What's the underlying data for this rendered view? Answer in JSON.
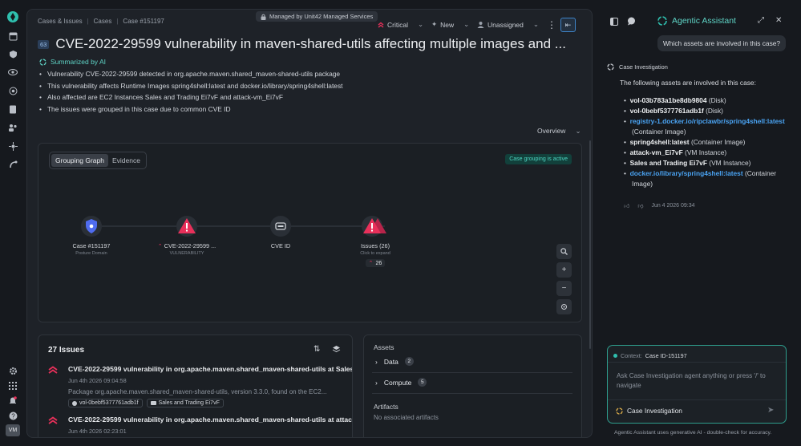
{
  "nav": {
    "avatar": "VM"
  },
  "breadcrumb": [
    "Cases & Issues",
    "Cases",
    "Case #151197"
  ],
  "managed_label": "Managed by Unit42 Managed Services",
  "header": {
    "severity": "Critical",
    "status": "New",
    "assignee": "Unassigned",
    "case_tag": "63",
    "title": "CVE-2022-29599 vulnerability in maven-shared-utils affecting multiple images and ..."
  },
  "summary": {
    "heading": "Summarized by AI",
    "bullets": [
      "Vulnerability CVE-2022-29599 detected in org.apache.maven.shared_maven-shared-utils package",
      "This vulnerability affects Runtime Images spring4shell:latest and docker.io/library/spring4shell:latest",
      "Also affected are EC2 Instances Sales and Trading Ei7vF and attack-vm_Ei7vF",
      "The issues were grouped in this case due to common CVE ID"
    ]
  },
  "overview_label": "Overview",
  "graph": {
    "tabs": [
      "Grouping Graph",
      "Evidence"
    ],
    "active_badge": "Case grouping is active",
    "nodes": [
      {
        "label": "Case #151197",
        "sub": "Posture Domain"
      },
      {
        "label": "CVE-2022-29599 ...",
        "sub": "VULNERABILITY"
      },
      {
        "label": "CVE ID",
        "sub": ""
      },
      {
        "label": "Issues (26)",
        "sub": "Click to expand"
      }
    ],
    "issue_count": "26"
  },
  "issues_panel": {
    "title": "27 Issues",
    "items": [
      {
        "title": "CVE-2022-29599 vulnerability in org.apache.maven.shared_maven-shared-utils at Sales...",
        "time": "Jun 4th 2026 09:04:58",
        "desc": "Package org.apache.maven.shared_maven-shared-utils, version 3.3.0, found on the EC2...",
        "chips": [
          "vol-0bebf5377761adb1f",
          "Sales and Trading Ei7vF"
        ]
      },
      {
        "title": "CVE-2022-29599 vulnerability in org.apache.maven.shared_maven-shared-utils at attac...",
        "time": "Jun 4th 2026 02:23:01"
      }
    ]
  },
  "assets_panel": {
    "title": "Assets",
    "groups": [
      {
        "label": "Data",
        "count": "2"
      },
      {
        "label": "Compute",
        "count": "5"
      }
    ],
    "artifacts_title": "Artifacts",
    "artifacts_empty": "No associated artifacts"
  },
  "assistant": {
    "title": "Agentic Assistant",
    "user_msg": "Which assets are involved in this case?",
    "agent_name": "Case Investigation",
    "intro": "The following assets are involved in this case:",
    "assets": [
      {
        "name": "vol-03b783a1be8db9804",
        "type": "(Disk)",
        "link": false
      },
      {
        "name": "vol-0bebf5377761adb1f",
        "type": "(Disk)",
        "link": false
      },
      {
        "name": "registry-1.docker.io/ripclawbr/spring4shell:latest",
        "type": "(Container Image)",
        "link": true
      },
      {
        "name": "spring4shell:latest",
        "type": "(Container Image)",
        "link": false
      },
      {
        "name": "attack-vm_Ei7vF",
        "type": "(VM Instance)",
        "link": false
      },
      {
        "name": "Sales and Trading Ei7vF",
        "type": "(VM Instance)",
        "link": false
      },
      {
        "name": "docker.io/library/spring4shell:latest",
        "type": "(Container Image)",
        "link": true
      }
    ],
    "timestamp": "Jun 4 2026 09:34",
    "context_label": "Context:",
    "context_value": "Case ID-151197",
    "input_placeholder": "Ask Case Investigation agent anything or press '/' to navigate",
    "agent_select": "Case Investigation",
    "footer": "Agentic Assistant uses generative AI - double-check for accuracy."
  },
  "colors": {
    "accent": "#2fbfae",
    "critical": "#e8305a",
    "link": "#4aa3f2",
    "shield": "#4f6cf0"
  }
}
